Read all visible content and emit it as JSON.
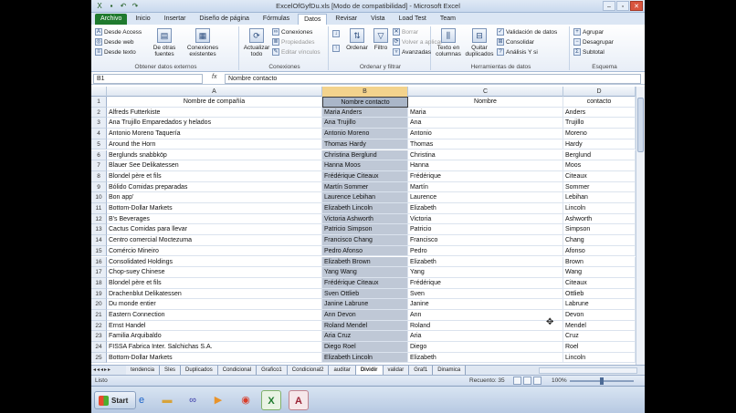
{
  "window": {
    "title": "ExcelOfGyfDu.xls  [Modo de compatibilidad] - Microsoft Excel"
  },
  "ribbon_tabs": [
    "Archivo",
    "Inicio",
    "Insertar",
    "Diseño de página",
    "Fórmulas",
    "Datos",
    "Revisar",
    "Vista",
    "Load Test",
    "Team"
  ],
  "ribbon": {
    "get_external": {
      "items": [
        "Desde Access",
        "Desde web",
        "Desde texto"
      ],
      "other": "De otras fuentes",
      "existing": "Conexiones existentes",
      "label": "Obtener datos externos"
    },
    "connections": {
      "refresh": "Actualizar todo",
      "items": [
        "Conexiones",
        "Propiedades",
        "Editar vínculos"
      ],
      "label": "Conexiones"
    },
    "sort_filter": {
      "sort": "Ordenar",
      "filter": "Filtro",
      "items": [
        "Borrar",
        "Volver a aplicar",
        "Avanzadas"
      ],
      "label": "Ordenar y filtrar"
    },
    "data_tools": {
      "text_to_cols": "Texto en columnas",
      "remove_dup": "Quitar duplicados",
      "items": [
        "Validación de datos",
        "Consolidar",
        "Análisis Y si"
      ],
      "label": "Herramientas de datos"
    },
    "outline": {
      "items": [
        "Agrupar",
        "Desagrupar",
        "Subtotal"
      ],
      "label": "Esquema"
    }
  },
  "formula_bar": {
    "name_box": "B1",
    "fx": "fx",
    "formula": "Nombre contacto"
  },
  "columns": [
    "A",
    "B",
    "C",
    "D"
  ],
  "rows": [
    [
      "Nombre de compañía",
      "Nombre contacto",
      "Nombre",
      "contacto"
    ],
    [
      "Alfreds Futterkiste",
      "Maria Anders",
      "Maria",
      "Anders"
    ],
    [
      "Ana Trujillo Emparedados y helados",
      "Ana Trujillo",
      "Ana",
      "Trujillo"
    ],
    [
      "Antonio Moreno Taquería",
      "Antonio Moreno",
      "Antonio",
      "Moreno"
    ],
    [
      "Around the Horn",
      "Thomas Hardy",
      "Thomas",
      "Hardy"
    ],
    [
      "Berglunds snabbköp",
      "Christina Berglund",
      "Christina",
      "Berglund"
    ],
    [
      "Blauer See Delikatessen",
      "Hanna Moos",
      "Hanna",
      "Moos"
    ],
    [
      "Blondel père et fils",
      "Frédérique Citeaux",
      "Frédérique",
      "Citeaux"
    ],
    [
      "Bólido Comidas preparadas",
      "Martín Sommer",
      "Martín",
      "Sommer"
    ],
    [
      "Bon app'",
      "Laurence Lebihan",
      "Laurence",
      "Lebihan"
    ],
    [
      "Bottom-Dollar Markets",
      "Elizabeth Lincoln",
      "Elizabeth",
      "Lincoln"
    ],
    [
      "B's Beverages",
      "Victoria Ashworth",
      "Victoria",
      "Ashworth"
    ],
    [
      "Cactus Comidas para llevar",
      "Patricio Simpson",
      "Patricio",
      "Simpson"
    ],
    [
      "Centro comercial Moctezuma",
      "Francisco Chang",
      "Francisco",
      "Chang"
    ],
    [
      "Comércio Mineiro",
      "Pedro Afonso",
      "Pedro",
      "Afonso"
    ],
    [
      "Consolidated Holdings",
      "Elizabeth Brown",
      "Elizabeth",
      "Brown"
    ],
    [
      "Chop-suey Chinese",
      "Yang Wang",
      "Yang",
      "Wang"
    ],
    [
      "Blondel père et fils",
      "Frédérique Citeaux",
      "Frédérique",
      "Citeaux"
    ],
    [
      "Drachenblut Delikatessen",
      "Sven Ottlieb",
      "Sven",
      "Ottlieb"
    ],
    [
      "Du monde entier",
      "Janine Labrune",
      "Janine",
      "Labrune"
    ],
    [
      "Eastern Connection",
      "Ann Devon",
      "Ann",
      "Devon"
    ],
    [
      "Ernst Handel",
      "Roland Mendel",
      "Roland",
      "Mendel"
    ],
    [
      "Familia Arquibaldo",
      "Aria Cruz",
      "Aria",
      "Cruz"
    ],
    [
      "FISSA Fabrica Inter. Salchichas S.A.",
      "Diego Roel",
      "Diego",
      "Roel"
    ],
    [
      "Bottom-Dollar Markets",
      "Elizabeth Lincoln",
      "Elizabeth",
      "Lincoln"
    ]
  ],
  "sheet_tabs": [
    "tendencia",
    "SIes",
    "Duplicados",
    "Condicional",
    "Grafico1",
    "Condicional2",
    "auditar",
    "Dividir",
    "validar",
    "Graf1",
    "Dinamica"
  ],
  "active_sheet": "Dividir",
  "status": {
    "ready": "Listo",
    "count": "Recuento: 35",
    "zoom": "100%"
  },
  "taskbar": {
    "start": "Start"
  }
}
